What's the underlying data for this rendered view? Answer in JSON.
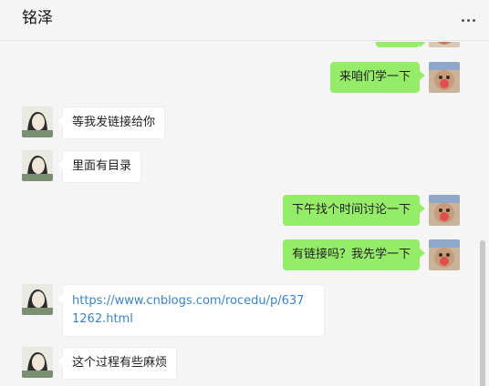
{
  "window": {
    "contact_name": "铭泽"
  },
  "messages": [
    {
      "side": "self",
      "text": "来咱们学一下"
    },
    {
      "side": "other",
      "text": "等我发链接给你"
    },
    {
      "side": "other",
      "text": "里面有目录"
    },
    {
      "side": "self",
      "text": "下午找个时间讨论一下"
    },
    {
      "side": "self",
      "text": "有链接吗？我先学一下"
    },
    {
      "side": "other",
      "text": "https://www.cnblogs.com/rocedu/p/637\n1262.html"
    },
    {
      "side": "other",
      "text": "这个过程有些麻烦"
    }
  ],
  "icons": {
    "more": "more-options-icon",
    "avatar_other": "avatar-illustrated-person",
    "avatar_self": "avatar-cartoon-bear"
  },
  "colors": {
    "self_bubble": "#95ec69",
    "other_bubble": "#ffffff",
    "link": "#3a83c5",
    "background": "#f5f5f5"
  }
}
